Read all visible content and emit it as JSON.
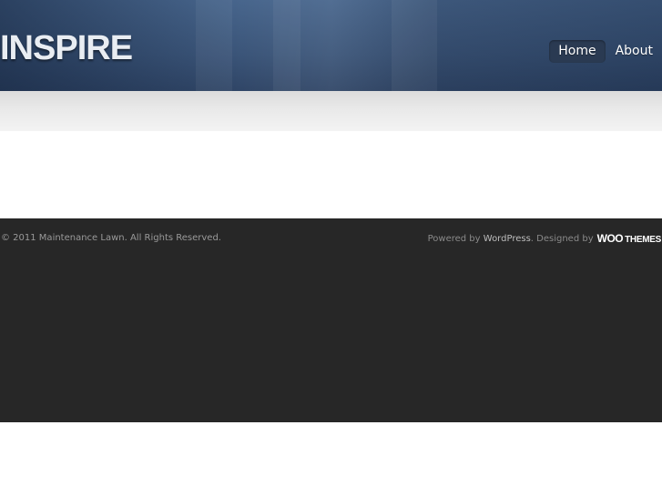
{
  "header": {
    "logo_text": "INSPIRE",
    "nav": [
      {
        "label": "Home",
        "active": true
      },
      {
        "label": "About",
        "active": false
      }
    ]
  },
  "footer": {
    "copyright": "© 2011 Maintenance Lawn. All Rights Reserved.",
    "powered_by_prefix": "Powered by",
    "wordpress_link": "WordPress",
    "designed_by": ". Designed by",
    "woo_logo": {
      "woo": "WOO",
      "themes": "THEMES"
    }
  },
  "colors": {
    "header_blue": "#3a5478",
    "footer_dark": "#272727",
    "nav_active_bg": "#2a3a52"
  }
}
